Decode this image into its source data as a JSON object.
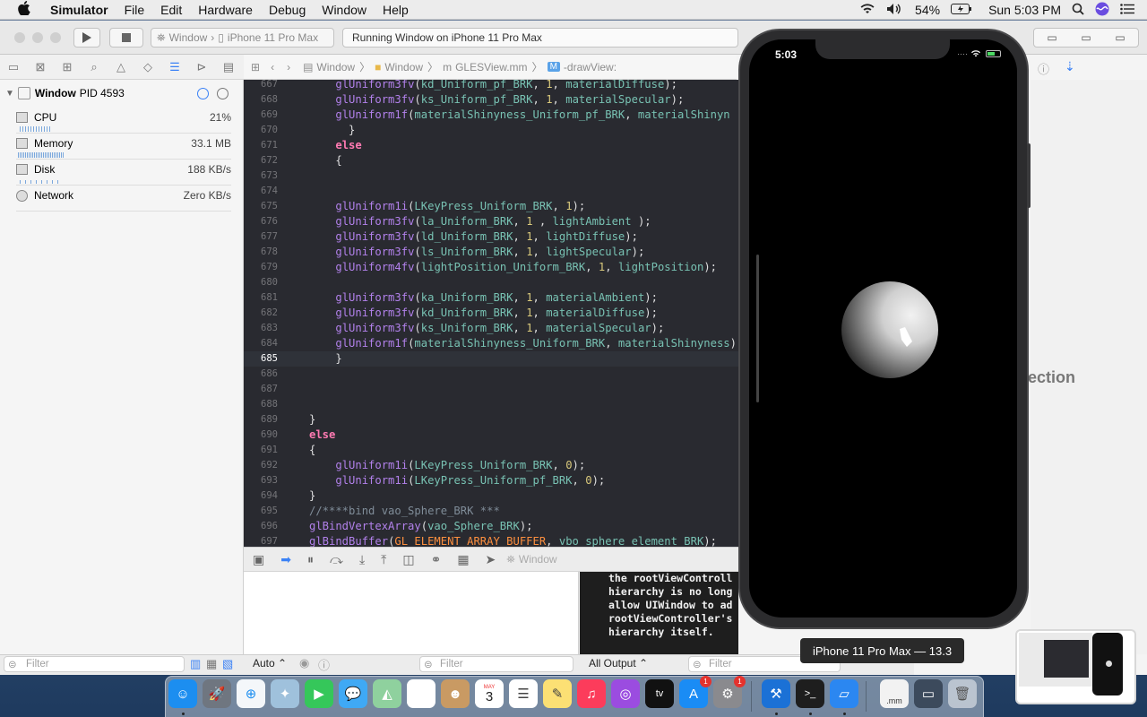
{
  "menubar": {
    "apple": "",
    "app_name": "Simulator",
    "items": [
      "File",
      "Edit",
      "Hardware",
      "Debug",
      "Window",
      "Help"
    ],
    "battery": "54%",
    "clock": "Sun 5:03 PM"
  },
  "toolbar": {
    "scheme_target": "Window",
    "scheme_device": "iPhone 11 Pro Max",
    "activity_status": "Running Window on iPhone 11 Pro Max"
  },
  "debug_navigator": {
    "process_name": "Window",
    "process_pid": "PID 4593",
    "gauges": [
      {
        "label": "CPU",
        "value": "21%"
      },
      {
        "label": "Memory",
        "value": "33.1 MB"
      },
      {
        "label": "Disk",
        "value": "188 KB/s"
      },
      {
        "label": "Network",
        "value": "Zero KB/s"
      }
    ],
    "filter_placeholder": "Filter"
  },
  "jump_bar": {
    "crumbs": [
      "Window",
      "Window",
      "GLESView.mm",
      "-drawView:"
    ]
  },
  "editor": {
    "current_line": "685",
    "lines": [
      {
        "n": "667",
        "code": "        glUniform3fv(kd_Uniform_pf_BRK, 1, materialDiffuse);"
      },
      {
        "n": "668",
        "code": "        glUniform3fv(ks_Uniform_pf_BRK, 1, materialSpecular);"
      },
      {
        "n": "669",
        "code": "        glUniform1f(materialShinyness_Uniform_pf_BRK, materialShinyn"
      },
      {
        "n": "670",
        "code": "          }"
      },
      {
        "n": "671",
        "code": "        else"
      },
      {
        "n": "672",
        "code": "        {"
      },
      {
        "n": "673",
        "code": ""
      },
      {
        "n": "674",
        "code": ""
      },
      {
        "n": "675",
        "code": "        glUniform1i(LKeyPress_Uniform_BRK, 1);"
      },
      {
        "n": "676",
        "code": "        glUniform3fv(la_Uniform_BRK, 1 , lightAmbient );"
      },
      {
        "n": "677",
        "code": "        glUniform3fv(ld_Uniform_BRK, 1, lightDiffuse);"
      },
      {
        "n": "678",
        "code": "        glUniform3fv(ls_Uniform_BRK, 1, lightSpecular);"
      },
      {
        "n": "679",
        "code": "        glUniform4fv(lightPosition_Uniform_BRK, 1, lightPosition);"
      },
      {
        "n": "680",
        "code": ""
      },
      {
        "n": "681",
        "code": "        glUniform3fv(ka_Uniform_BRK, 1, materialAmbient);"
      },
      {
        "n": "682",
        "code": "        glUniform3fv(kd_Uniform_BRK, 1, materialDiffuse);"
      },
      {
        "n": "683",
        "code": "        glUniform3fv(ks_Uniform_BRK, 1, materialSpecular);"
      },
      {
        "n": "684",
        "code": "        glUniform1f(materialShinyness_Uniform_BRK, materialShinyness)"
      },
      {
        "n": "685",
        "code": "        }"
      },
      {
        "n": "686",
        "code": ""
      },
      {
        "n": "687",
        "code": ""
      },
      {
        "n": "688",
        "code": ""
      },
      {
        "n": "689",
        "code": "    }"
      },
      {
        "n": "690",
        "code": "    else"
      },
      {
        "n": "691",
        "code": "    {"
      },
      {
        "n": "692",
        "code": "        glUniform1i(LKeyPress_Uniform_BRK, 0);"
      },
      {
        "n": "693",
        "code": "        glUniform1i(LKeyPress_Uniform_pf_BRK, 0);"
      },
      {
        "n": "694",
        "code": "    }"
      },
      {
        "n": "695",
        "code": "    //****bind vao_Sphere_BRK ***"
      },
      {
        "n": "696",
        "code": "    glBindVertexArray(vao_Sphere_BRK);"
      },
      {
        "n": "697",
        "code": "    glBindBuffer(GL_ELEMENT_ARRAY_BUFFER, vbo_sphere_element_BRK);"
      }
    ]
  },
  "debug_bar": {
    "process": "Window"
  },
  "console": {
    "lines": [
      "the rootViewControll",
      "hierarchy is no long",
      "allow UIWindow to ad",
      "rootViewController's",
      "hierarchy itself."
    ],
    "output_selector": "All Output",
    "filter_placeholder": "Filter"
  },
  "variables": {
    "scope": "Auto",
    "filter_placeholder": "Filter"
  },
  "inspector": {
    "partial_text": "lection"
  },
  "simulator": {
    "time": "5:03",
    "device_tooltip": "iPhone 11 Pro Max — 13.3"
  },
  "dock": {
    "calendar_month": "MAY",
    "calendar_day": "3",
    "file_label": ".mm",
    "badges": {
      "appstore": "1",
      "prefs": "1"
    }
  },
  "colors": {
    "accent": "#3b82f6",
    "editor_bg": "#292a30"
  }
}
